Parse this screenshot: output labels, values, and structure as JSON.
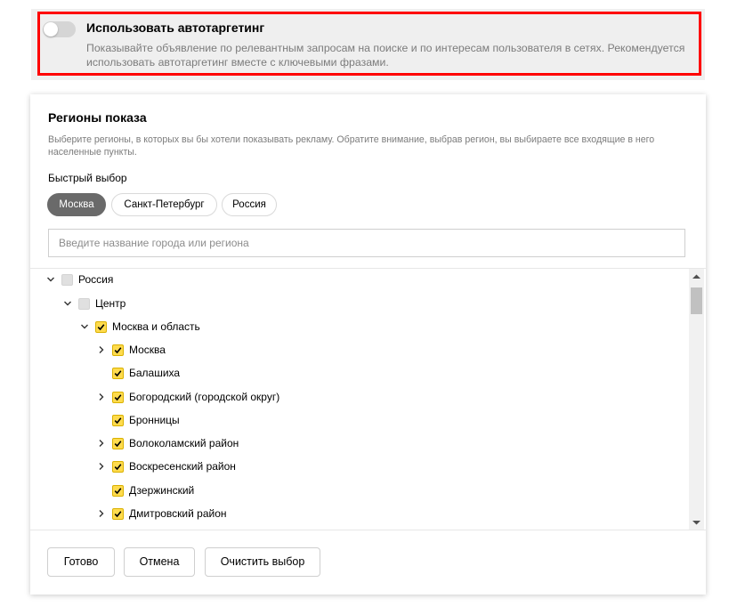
{
  "autotargeting": {
    "title": "Использовать автотаргетинг",
    "description": "Показывайте объявление по релевантным запросам на поиске и по интересам пользователя в сетях. Рекомендуется использовать автотаргетинг вместе с ключевыми фразами.",
    "enabled": false,
    "highlight_color": "#ff0000"
  },
  "regions": {
    "title": "Регионы показа",
    "description": "Выберите регионы, в которых вы бы хотели показывать рекламу. Обратите внимание, выбрав регион, вы выбираете все входящие в него населенные пункты.",
    "quick_label": "Быстрый выбор",
    "quick_chips": [
      {
        "label": "Москва",
        "active": true
      },
      {
        "label": "Санкт-Петербург",
        "active": false
      },
      {
        "label": "Россия",
        "active": false
      }
    ],
    "search_placeholder": "Введите название города или региона",
    "tree": [
      {
        "label": "Россия",
        "checked": false,
        "expandable": true,
        "expanded": true
      },
      {
        "label": "Центр",
        "checked": false,
        "expandable": true,
        "expanded": true
      },
      {
        "label": "Москва и область",
        "checked": true,
        "expandable": true,
        "expanded": true
      },
      {
        "label": "Москва",
        "checked": true,
        "expandable": true,
        "expanded": false
      },
      {
        "label": "Балашиха",
        "checked": true,
        "expandable": false,
        "expanded": false
      },
      {
        "label": "Богородский (городской округ)",
        "checked": true,
        "expandable": true,
        "expanded": false
      },
      {
        "label": "Бронницы",
        "checked": true,
        "expandable": false,
        "expanded": false
      },
      {
        "label": "Волоколамский район",
        "checked": true,
        "expandable": true,
        "expanded": false
      },
      {
        "label": "Воскресенский район",
        "checked": true,
        "expandable": true,
        "expanded": false
      },
      {
        "label": "Дзержинский",
        "checked": true,
        "expandable": false,
        "expanded": false
      },
      {
        "label": "Дмитровский район",
        "checked": true,
        "expandable": true,
        "expanded": false
      }
    ],
    "buttons": {
      "done": "Готово",
      "cancel": "Отмена",
      "clear": "Очистить выбор"
    }
  },
  "colors": {
    "checkbox_checked": "#ffdb4d",
    "chip_active": "#6a6a6a"
  }
}
